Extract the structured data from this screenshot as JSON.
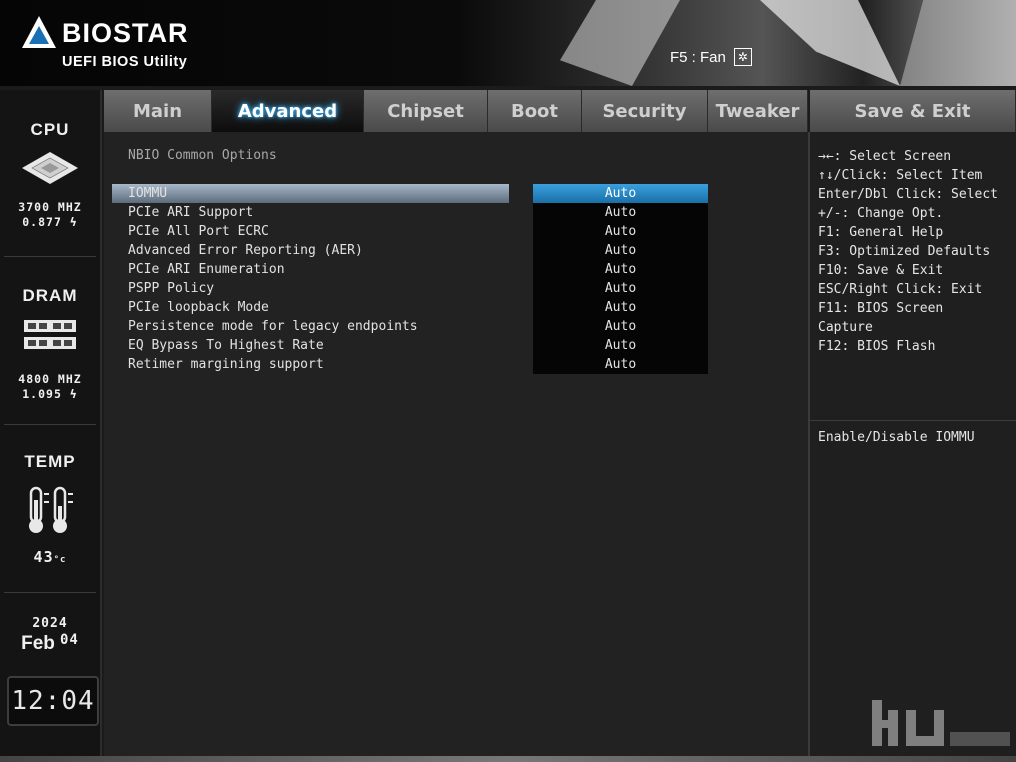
{
  "header": {
    "brand": "BIOSTAR",
    "subtitle": "UEFI BIOS Utility",
    "fan_label": "F5 : Fan"
  },
  "sidebar": {
    "cpu": {
      "title": "CPU",
      "freq": "3700 MHZ",
      "voltage": "0.877"
    },
    "dram": {
      "title": "DRAM",
      "freq": "4800 MHZ",
      "voltage": "1.095"
    },
    "temp": {
      "title": "TEMP",
      "value": "43"
    },
    "date": {
      "year": "2024",
      "month": "Feb",
      "day": "04"
    },
    "clock": "12:04"
  },
  "tabs": [
    {
      "label": "Main"
    },
    {
      "label": "Advanced",
      "active": true
    },
    {
      "label": "Chipset"
    },
    {
      "label": "Boot"
    },
    {
      "label": "Security"
    },
    {
      "label": "Tweaker"
    },
    {
      "label": "Save & Exit"
    }
  ],
  "main": {
    "section_title": "NBIO Common Options",
    "options": [
      {
        "label": "IOMMU",
        "value": "Auto",
        "selected": true
      },
      {
        "label": "PCIe ARI Support",
        "value": "Auto"
      },
      {
        "label": "PCIe All Port ECRC",
        "value": "Auto"
      },
      {
        "label": "Advanced Error Reporting (AER)",
        "value": "Auto"
      },
      {
        "label": "PCIe ARI Enumeration",
        "value": "Auto"
      },
      {
        "label": "PSPP Policy",
        "value": "Auto"
      },
      {
        "label": "PCIe loopback Mode",
        "value": "Auto"
      },
      {
        "label": "Persistence mode for legacy endpoints",
        "value": "Auto"
      },
      {
        "label": "EQ Bypass To Highest Rate",
        "value": "Auto"
      },
      {
        "label": "Retimer margining support",
        "value": "Auto"
      }
    ]
  },
  "help": {
    "keys": [
      "→←: Select Screen",
      "↑↓/Click: Select Item",
      "Enter/Dbl Click: Select",
      "+/-: Change Opt.",
      "F1: General Help",
      "F3: Optimized Defaults",
      "F10: Save & Exit",
      "ESC/Right Click: Exit",
      "F11: BIOS Screen",
      "Capture",
      "F12: BIOS Flash"
    ],
    "description": "Enable/Disable IOMMU"
  },
  "icons": {
    "cpu": "cpu-chip-icon",
    "dram": "memory-module-icon",
    "temp": "thermometer-icon",
    "fan": "fan-icon",
    "voltage": "lightning-bolt-icon"
  },
  "colors": {
    "accent_blue": "#2a8fd0",
    "tab_active_glow": "#3fb6ff",
    "row_highlight": "#8696a8"
  }
}
